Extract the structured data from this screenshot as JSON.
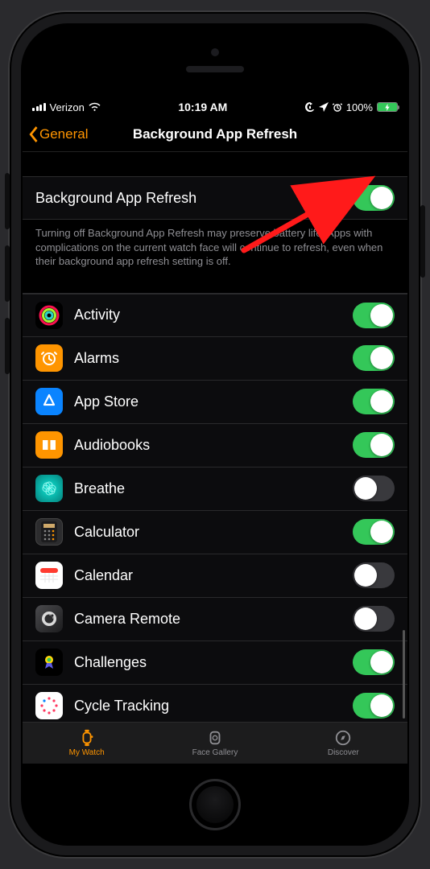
{
  "status_bar": {
    "carrier": "Verizon",
    "time": "10:19 AM",
    "battery_pct": "100%"
  },
  "nav": {
    "back_label": "General",
    "title": "Background App Refresh"
  },
  "master_toggle": {
    "label": "Background App Refresh",
    "on": true,
    "footer": "Turning off Background App Refresh may preserve battery life. Apps with complications on the current watch face will continue to refresh, even when their background app refresh setting is off."
  },
  "apps": [
    {
      "id": "activity",
      "label": "Activity",
      "on": true
    },
    {
      "id": "alarms",
      "label": "Alarms",
      "on": true
    },
    {
      "id": "appstore",
      "label": "App Store",
      "on": true
    },
    {
      "id": "audiobooks",
      "label": "Audiobooks",
      "on": true
    },
    {
      "id": "breathe",
      "label": "Breathe",
      "on": false
    },
    {
      "id": "calculator",
      "label": "Calculator",
      "on": true
    },
    {
      "id": "calendar",
      "label": "Calendar",
      "on": false
    },
    {
      "id": "camera",
      "label": "Camera Remote",
      "on": false
    },
    {
      "id": "challenges",
      "label": "Challenges",
      "on": true
    },
    {
      "id": "cycle",
      "label": "Cycle Tracking",
      "on": true
    }
  ],
  "tabs": [
    {
      "id": "my-watch",
      "label": "My Watch",
      "active": true
    },
    {
      "id": "face-gallery",
      "label": "Face Gallery",
      "active": false
    },
    {
      "id": "discover",
      "label": "Discover",
      "active": false
    }
  ]
}
